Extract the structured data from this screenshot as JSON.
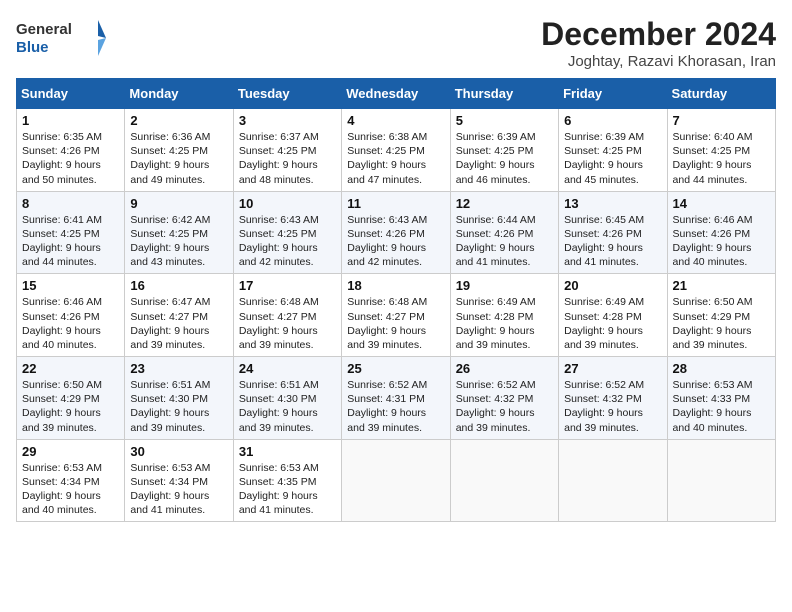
{
  "header": {
    "logo_general": "General",
    "logo_blue": "Blue",
    "title": "December 2024",
    "subtitle": "Joghtay, Razavi Khorasan, Iran"
  },
  "calendar": {
    "weekdays": [
      "Sunday",
      "Monday",
      "Tuesday",
      "Wednesday",
      "Thursday",
      "Friday",
      "Saturday"
    ],
    "weeks": [
      [
        null,
        {
          "day": "2",
          "sunrise": "6:36 AM",
          "sunset": "4:25 PM",
          "daylight": "9 hours and 49 minutes."
        },
        {
          "day": "3",
          "sunrise": "6:37 AM",
          "sunset": "4:25 PM",
          "daylight": "9 hours and 48 minutes."
        },
        {
          "day": "4",
          "sunrise": "6:38 AM",
          "sunset": "4:25 PM",
          "daylight": "9 hours and 47 minutes."
        },
        {
          "day": "5",
          "sunrise": "6:39 AM",
          "sunset": "4:25 PM",
          "daylight": "9 hours and 46 minutes."
        },
        {
          "day": "6",
          "sunrise": "6:39 AM",
          "sunset": "4:25 PM",
          "daylight": "9 hours and 45 minutes."
        },
        {
          "day": "7",
          "sunrise": "6:40 AM",
          "sunset": "4:25 PM",
          "daylight": "9 hours and 44 minutes."
        }
      ],
      [
        {
          "day": "1",
          "sunrise": "6:35 AM",
          "sunset": "4:26 PM",
          "daylight": "9 hours and 50 minutes."
        },
        null,
        null,
        null,
        null,
        null,
        null
      ],
      [
        {
          "day": "8",
          "sunrise": "6:41 AM",
          "sunset": "4:25 PM",
          "daylight": "9 hours and 44 minutes."
        },
        {
          "day": "9",
          "sunrise": "6:42 AM",
          "sunset": "4:25 PM",
          "daylight": "9 hours and 43 minutes."
        },
        {
          "day": "10",
          "sunrise": "6:43 AM",
          "sunset": "4:25 PM",
          "daylight": "9 hours and 42 minutes."
        },
        {
          "day": "11",
          "sunrise": "6:43 AM",
          "sunset": "4:26 PM",
          "daylight": "9 hours and 42 minutes."
        },
        {
          "day": "12",
          "sunrise": "6:44 AM",
          "sunset": "4:26 PM",
          "daylight": "9 hours and 41 minutes."
        },
        {
          "day": "13",
          "sunrise": "6:45 AM",
          "sunset": "4:26 PM",
          "daylight": "9 hours and 41 minutes."
        },
        {
          "day": "14",
          "sunrise": "6:46 AM",
          "sunset": "4:26 PM",
          "daylight": "9 hours and 40 minutes."
        }
      ],
      [
        {
          "day": "15",
          "sunrise": "6:46 AM",
          "sunset": "4:26 PM",
          "daylight": "9 hours and 40 minutes."
        },
        {
          "day": "16",
          "sunrise": "6:47 AM",
          "sunset": "4:27 PM",
          "daylight": "9 hours and 39 minutes."
        },
        {
          "day": "17",
          "sunrise": "6:48 AM",
          "sunset": "4:27 PM",
          "daylight": "9 hours and 39 minutes."
        },
        {
          "day": "18",
          "sunrise": "6:48 AM",
          "sunset": "4:27 PM",
          "daylight": "9 hours and 39 minutes."
        },
        {
          "day": "19",
          "sunrise": "6:49 AM",
          "sunset": "4:28 PM",
          "daylight": "9 hours and 39 minutes."
        },
        {
          "day": "20",
          "sunrise": "6:49 AM",
          "sunset": "4:28 PM",
          "daylight": "9 hours and 39 minutes."
        },
        {
          "day": "21",
          "sunrise": "6:50 AM",
          "sunset": "4:29 PM",
          "daylight": "9 hours and 39 minutes."
        }
      ],
      [
        {
          "day": "22",
          "sunrise": "6:50 AM",
          "sunset": "4:29 PM",
          "daylight": "9 hours and 39 minutes."
        },
        {
          "day": "23",
          "sunrise": "6:51 AM",
          "sunset": "4:30 PM",
          "daylight": "9 hours and 39 minutes."
        },
        {
          "day": "24",
          "sunrise": "6:51 AM",
          "sunset": "4:30 PM",
          "daylight": "9 hours and 39 minutes."
        },
        {
          "day": "25",
          "sunrise": "6:52 AM",
          "sunset": "4:31 PM",
          "daylight": "9 hours and 39 minutes."
        },
        {
          "day": "26",
          "sunrise": "6:52 AM",
          "sunset": "4:32 PM",
          "daylight": "9 hours and 39 minutes."
        },
        {
          "day": "27",
          "sunrise": "6:52 AM",
          "sunset": "4:32 PM",
          "daylight": "9 hours and 39 minutes."
        },
        {
          "day": "28",
          "sunrise": "6:53 AM",
          "sunset": "4:33 PM",
          "daylight": "9 hours and 40 minutes."
        }
      ],
      [
        {
          "day": "29",
          "sunrise": "6:53 AM",
          "sunset": "4:34 PM",
          "daylight": "9 hours and 40 minutes."
        },
        {
          "day": "30",
          "sunrise": "6:53 AM",
          "sunset": "4:34 PM",
          "daylight": "9 hours and 41 minutes."
        },
        {
          "day": "31",
          "sunrise": "6:53 AM",
          "sunset": "4:35 PM",
          "daylight": "9 hours and 41 minutes."
        },
        null,
        null,
        null,
        null
      ]
    ]
  }
}
